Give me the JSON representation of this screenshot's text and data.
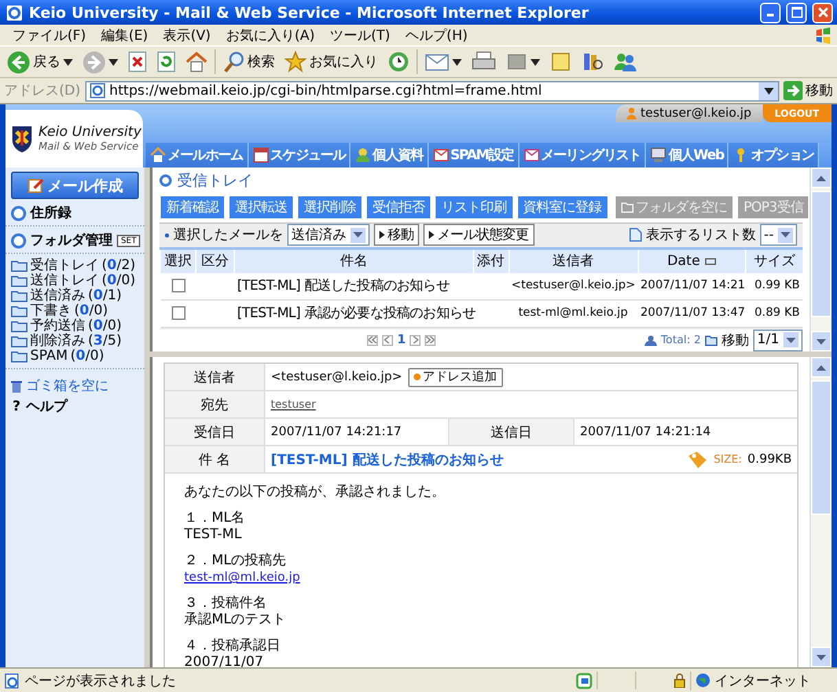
{
  "window": {
    "title": "Keio University - Mail & Web Service - Microsoft Internet Explorer"
  },
  "menu_bar": [
    "ファイル(F)",
    "編集(E)",
    "表示(V)",
    "お気に入り(A)",
    "ツール(T)",
    "ヘルプ(H)"
  ],
  "toolbar": {
    "back": "戻る",
    "search": "検索",
    "favorites": "お気に入り"
  },
  "address_bar": {
    "label": "アドレス(D)",
    "url": "https://webmail.keio.jp/cgi-bin/htmlparse.cgi?html=frame.html",
    "go": "移動"
  },
  "header": {
    "logo_title": "Keio University",
    "logo_subtitle": "Mail & Web Service",
    "user": "testuser@l.keio.jp",
    "logout": "LOGOUT",
    "nav": [
      "メールホーム",
      "スケジュール",
      "個人資料",
      "SPAM設定",
      "メーリングリスト",
      "個人Web",
      "オプション"
    ]
  },
  "sidebar": {
    "compose": "メール作成",
    "address_book": "住所録",
    "folder_manage": "フォルダ管理",
    "folder_manage_badge": "SET",
    "folders": [
      {
        "name": "受信トレイ",
        "count": "(**0**/2)"
      },
      {
        "name": "送信トレイ",
        "count": "(**0**/0)"
      },
      {
        "name": "送信済み",
        "count": "(**0**/1)"
      },
      {
        "name": "下書き",
        "count": "(**0**/0)"
      },
      {
        "name": "予約送信",
        "count": "(**0**/0)"
      },
      {
        "name": "削除済み",
        "count": "(**3**/5)"
      },
      {
        "name": "SPAM",
        "count": "(**0**/0)"
      }
    ],
    "empty_trash": "ゴミ箱を空に",
    "help_mark": "?",
    "help": "ヘルプ"
  },
  "inbox": {
    "title": "受信トレイ",
    "buttons": [
      {
        "label": "新着確認",
        "disabled": false
      },
      {
        "label": "選択転送",
        "disabled": false
      },
      {
        "label": "選択削除",
        "disabled": false
      },
      {
        "label": "受信拒否",
        "disabled": false
      },
      {
        "label": "リスト印刷",
        "disabled": false
      },
      {
        "label": "資料室に登録",
        "disabled": false
      }
    ],
    "right_buttons": [
      {
        "label": "フォルダを空に",
        "disabled": true
      },
      {
        "label": "POP3受信",
        "disabled": true
      }
    ],
    "move_bar": {
      "label": "選択したメールを",
      "folder": "送信済み",
      "move": "移動",
      "status_change": "メール状態変更",
      "list_count_label": "表示するリスト数",
      "list_count": "--"
    },
    "table": {
      "columns": [
        "選択",
        "区分",
        "件名",
        "添付",
        "送信者",
        "Date",
        "サイズ"
      ],
      "rows": [
        {
          "checked": false,
          "subject": "[TEST-ML] 配送した投稿のお知らせ",
          "sender": "<testuser@l.keio.jp>",
          "date": "2007/11/07 14:21",
          "size": "0.99 KB"
        },
        {
          "checked": false,
          "subject": "[TEST-ML] 承認が必要な投稿のお知らせ",
          "sender": "test-ml@ml.keio.jp",
          "date": "2007/11/07 13:47",
          "size": "0.89 KB"
        }
      ]
    },
    "pager": {
      "page": "1",
      "total": "Total: 2",
      "move": "移動",
      "page_select": "1/1"
    }
  },
  "message": {
    "sender_label": "送信者",
    "sender": "<testuser@l.keio.jp>",
    "add_address": "アドレス追加",
    "to_label": "宛先",
    "to": "testuser",
    "received_label": "受信日",
    "received": "2007/11/07 14:21:17",
    "sent_label": "送信日",
    "sent": "2007/11/07 14:21:14",
    "subject_label": "件 名",
    "subject": "[TEST-ML] 配送した投稿のお知らせ",
    "size_label": "SIZE:",
    "size": "0.99KB",
    "body": [
      [
        {
          "kind": "text",
          "text": "あなたの以下の投稿が、承認されました。"
        }
      ],
      [
        {
          "kind": "text",
          "text": "１．ML名"
        },
        {
          "kind": "text",
          "text": "TEST-ML"
        }
      ],
      [
        {
          "kind": "text",
          "text": "２．MLの投稿先"
        },
        {
          "kind": "link",
          "text": "test-ml@ml.keio.jp"
        }
      ],
      [
        {
          "kind": "text",
          "text": "３．投稿件名"
        },
        {
          "kind": "text",
          "text": "承認MLのテスト"
        }
      ],
      [
        {
          "kind": "text",
          "text": "４．投稿承認日"
        },
        {
          "kind": "text",
          "text": "2007/11/07"
        }
      ]
    ]
  },
  "status_bar": {
    "text": "ページが表示されました",
    "zone": "インターネット"
  }
}
